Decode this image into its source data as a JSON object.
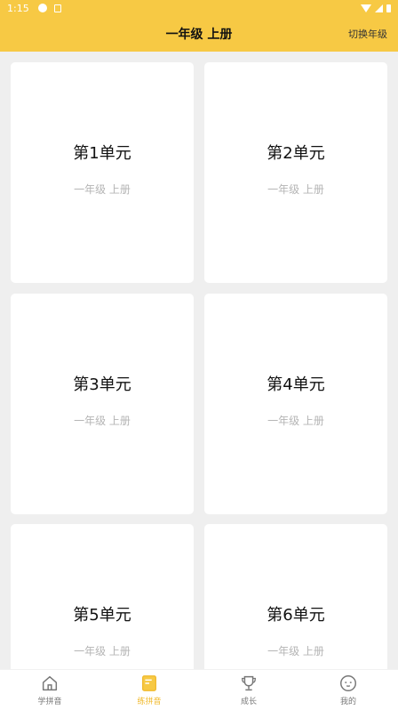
{
  "status_bar": {
    "time": "1:15"
  },
  "header": {
    "title": "一年级 上册",
    "action_label": "切换年级"
  },
  "cards": [
    {
      "title": "第1单元",
      "subtitle": "一年级 上册"
    },
    {
      "title": "第2单元",
      "subtitle": "一年级 上册"
    },
    {
      "title": "第3单元",
      "subtitle": "一年级 上册"
    },
    {
      "title": "第4单元",
      "subtitle": "一年级 上册"
    },
    {
      "title": "第5单元",
      "subtitle": "一年级 上册"
    },
    {
      "title": "第6单元",
      "subtitle": "一年级 上册"
    }
  ],
  "bottom_nav": {
    "items": [
      {
        "label": "学拼音",
        "icon": "home-icon"
      },
      {
        "label": "练拼音",
        "icon": "book-icon"
      },
      {
        "label": "成长",
        "icon": "trophy-icon"
      },
      {
        "label": "我的",
        "icon": "face-icon"
      }
    ],
    "active_index": 1,
    "active_color": "#f0b92c",
    "inactive_color": "#777777"
  },
  "colors": {
    "accent": "#f7c944",
    "background": "#efefef",
    "card": "#ffffff"
  }
}
